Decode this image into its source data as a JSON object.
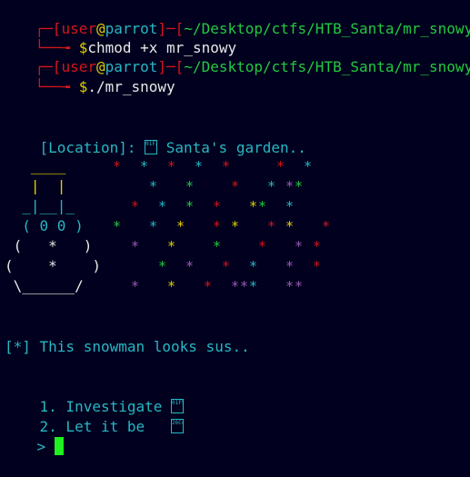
{
  "prompts": [
    {
      "open": "┌─[",
      "user": "user",
      "at": "@",
      "host": "parrot",
      "mid": "]─[",
      "path": "~/Desktop/ctfs/HTB_Santa/mr_snowy",
      "close": "]",
      "lead": "└──╼ ",
      "dollar": "$",
      "command": "chmod +x mr_snowy"
    },
    {
      "open": "┌─[",
      "user": "user",
      "at": "@",
      "host": "parrot",
      "mid": "]─[",
      "path": "~/Desktop/ctfs/HTB_Santa/mr_snowy",
      "close": "]",
      "lead": "└──╼ ",
      "dollar": "$",
      "command": "./mr_snowy"
    }
  ],
  "location": {
    "label": "[Location]: ",
    "glyph": "01F385",
    "text": " Santa's garden.."
  },
  "snowman": [
    "   ____ ",
    "   |  | ",
    "  _|__|_",
    "  ( 0 0 )",
    " (   *   )",
    "(    *    )",
    " \\______/ "
  ],
  "snowman_colors": {
    "hat": "#e0d000",
    "brim": "#27b7c4",
    "body": "#27b7c4",
    "buttons": "#e0d000",
    "belly": "#d2161b"
  },
  "stars_colors": [
    "#d2161b",
    "#27b7c4",
    "#23c93f",
    "#e0d000",
    "#9b59b6"
  ],
  "message": "[*] This snowman looks sus..",
  "options": [
    {
      "text": "1. Investigate ",
      "glyph": "01F50E"
    },
    {
      "text": "2. Let it be   ",
      "glyph": "26C4"
    }
  ],
  "input_prompt": "> "
}
